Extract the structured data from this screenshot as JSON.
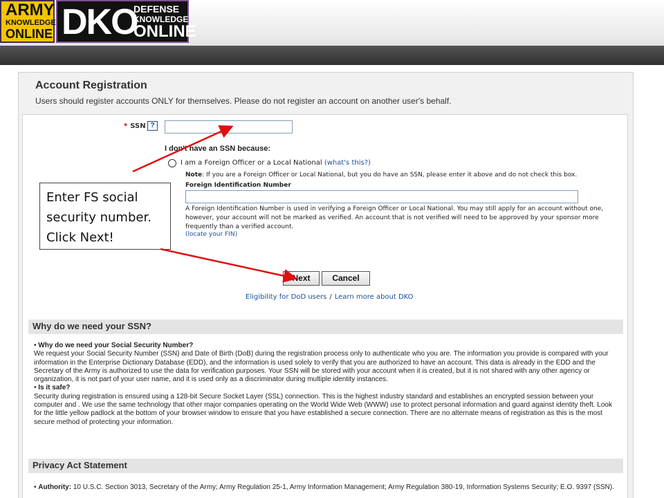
{
  "header": {
    "ako_logo": {
      "line1": "ARMY",
      "line2": "KNOWLEDGE",
      "line3": "ONLINE"
    },
    "dko_logo": {
      "big": "DKO",
      "line1": "DEFENSE",
      "line2": "KNOWLEDGE",
      "line3": "ONLINE"
    }
  },
  "registration": {
    "title": "Account Registration",
    "subtitle": "Users should register accounts ONLY for themselves. Please do not register an account on another user's behalf.",
    "ssn_required_mark": "*",
    "ssn_label": "SSN",
    "help_icon_text": "?",
    "ssn_value": "",
    "no_ssn_heading": "I don't have an SSN because:",
    "foreign_officer_label": "I am a Foreign Officer or a Local National",
    "whats_this_link": "(what's this?)",
    "note_label": "Note",
    "note_text": ": If you are a Foreign Officer or Local National, but you do have an SSN, please enter it above and do not check this box.",
    "fin_label": "Foreign Identification Number",
    "fin_value": "",
    "fin_description": "A Foreign Identification Number is used in verifying a Foreign Officer or Local National. You may still apply for an account without one, however, your account will not be marked as verified. An account that is not verified will need to be approved by your sponsor more frequently than a verified account.",
    "locate_fin_link": "(locate your FIN)",
    "next_button": "Next",
    "cancel_button": "Cancel",
    "eligibility_link": "Eligibility for DoD users",
    "link_separator": "/",
    "learn_more_link": "Learn more about DKO"
  },
  "why_section": {
    "heading": "Why do we need your SSN?",
    "q1": "Why do we need your Social Security Number?",
    "a1": "We request your Social Security Number (SSN) and Date of Birth (DoB) during the registration process only to authenticate who you are. The information you provide is compared with your information in the Enterprise Dictionary Database (EDD), and the information is used solely to verify that you are authorized to have an account. This data is already in the EDD and the Secretary of the Army is authorized to use the data for verification purposes. Your SSN will be stored with your account when it is created, but it is not shared with any other agency or organization, it is not part of your user name, and it is used only as a discriminator during multiple identity instances.",
    "q2": "Is it safe?",
    "a2": "Security during registration is ensured using a 128-bit Secure Socket Layer (SSL) connection. This is the highest industry standard and establishes an encrypted session between your computer and . We use the same technology that other major companies operating on the World Wide Web (WWW) use to protect personal information and guard against identity theft. Look for the little yellow padlock at the bottom of your browser window to ensure that you have established a secure connection. There are no alternate means of registration as this is the most secure method of protecting your information."
  },
  "privacy_section": {
    "heading": "Privacy Act Statement",
    "authority_label": "Authority:",
    "authority_text": "10 U.S.C. Section 3013, Secretary of the Army; Army Regulation 25-1, Army Information Management; Army Regulation 380-19, Information Systems Security; E.O. 9397 (SSN)."
  },
  "callout": {
    "line1": "Enter FS social",
    "line2": "security number.",
    "line3": "Click Next!"
  },
  "colors": {
    "arrow": "#e01010",
    "link": "#1d4f9a",
    "ako_gold": "#f3c400",
    "dko_purple": "#7b4f94"
  }
}
